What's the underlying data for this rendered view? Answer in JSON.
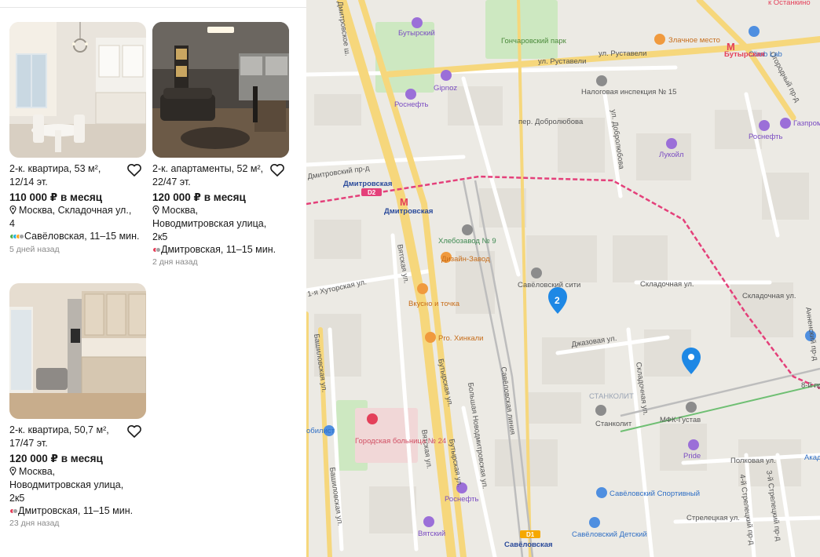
{
  "listings": [
    {
      "title": "2-к. квартира, 53 м², 12/14 эт.",
      "price": "110 000 ₽ в месяц",
      "address": "Москва, Складочная ул., 4",
      "metro": "Савёловская, 11–15 мин.",
      "metro_colors": [
        "#4fb04f",
        "#24b1de",
        "#ffa51f",
        "#a1a2a3"
      ],
      "date": "5 дней назад",
      "photo": "bright-kitchen-dining"
    },
    {
      "title": "2-к. апартаменты, 52 м², 22/47 эт.",
      "price": "120 000 ₽ в месяц",
      "address": "Москва, Новодмитровская улица, 2к5",
      "metro": "Дмитровская, 11–15 мин.",
      "metro_colors": [
        "#e4405a",
        "#a1a2a3"
      ],
      "date": "2 дня назад",
      "photo": "dark-living-room"
    },
    {
      "title": "2-к. квартира, 50,7 м², 17/47 эт.",
      "price": "120 000 ₽ в месяц",
      "address": "Москва, Новодмитровская улица, 2к5",
      "metro": "Дмитровская, 11–15 мин.",
      "metro_colors": [
        "#e4405a",
        "#a1a2a3"
      ],
      "date": "23 дня назад",
      "photo": "beige-kitchen"
    }
  ],
  "map": {
    "streets": {
      "rustaveli_1": "ул. Руставели",
      "rustaveli_2": "ул. Руставели",
      "dobrolyubova_1": "пер. Добролюбова",
      "dobrolyubova_2": "ул. Добролюбова",
      "ogorodny": "Огородный пр-д",
      "dmitrovsky_ave": "Дмитровский пр-д",
      "khutorskaya": "1-я Хуторская ул.",
      "vyatskaya_1": "Вятская ул.",
      "vyatskaya_2": "Вятская ул.",
      "butyrskaya_1": "Бутырская ул.",
      "butyrskaya_2": "Бутырская ул.",
      "novodmitrovskaya": "Большая Новодмитровская ул.",
      "savelovskaya_line": "Савёловская линия",
      "bashilovskaya_1": "Башиловская ул.",
      "bashilovskaya_2": "Башиловская ул.",
      "skladochnaya_1": "Складочная ул.",
      "skladochnaya_2": "Складочная ул.",
      "skladochnaya_3": "Складочная ул.",
      "dzhazovaya": "Джазовая ул.",
      "amursky": "Анненский пр-д",
      "street_8": "8-й пр",
      "polkovaya": "Полковая ул.",
      "streletskaya": "Стрелецкая ул.",
      "streletsky_3": "3-й Стрелецкий пр-д",
      "streletsky_4": "4-й Стрелецкий пр-д",
      "dmitrovskoe_sh": "Дмитровское ш."
    },
    "pois": {
      "ostankino": "к Останкино",
      "butyrsky": "Бутырский",
      "goncharovsky": "Гончаровский парк",
      "zlachnoe": "Злачное место",
      "climb_lab": "Climb Lab",
      "butyrskaya_metro": "Бутырская",
      "gipnoz": "Gipnoz",
      "rosneft_1": "Роснефть",
      "nalogovaya": "Налоговая инспекция № 15",
      "rosneft_2": "Роснефть",
      "gazprom": "Газпром",
      "lukoil": "Лукойл",
      "dmitrovskaya_d2": "Дмитровская",
      "dmitrovskaya_metro": "Дмитровская",
      "khlebozavod": "Хлебозавод № 9",
      "design_zavod": "Дизайн-Завод",
      "savelovsky_city": "Савёловский сити",
      "vkusno": "Вкусно и точка",
      "pro_khinkali": "Pro. Хинкали",
      "stankolit_area": "СТАНКОЛИТ",
      "stankolit": "Станколит",
      "mfk_gustav": "МФК-Густав",
      "pride": "Pride",
      "akad": "Акад",
      "dobilist": "обилист",
      "hospital": "Городская больница № 24",
      "rosneft_3": "Роснефть",
      "savelovsky_sport": "Савёловский Спортивный",
      "vyatsky": "Вятский",
      "savelovskaya_station": "Савёловская",
      "savelovsky_detsky": "Савёловский Детский"
    },
    "cluster_count": "2",
    "line_labels": {
      "d2": "D2",
      "d1": "D1"
    }
  },
  "colors": {
    "map_bg": "#eceae4",
    "road_major": "#f6d77c",
    "road_minor": "#ffffff",
    "park": "#cde8c1",
    "railway": "#bdbdbd",
    "mcd_line": "#e4407a",
    "pin_blue": "#1e88e5",
    "metro_red": "#e4405a"
  }
}
